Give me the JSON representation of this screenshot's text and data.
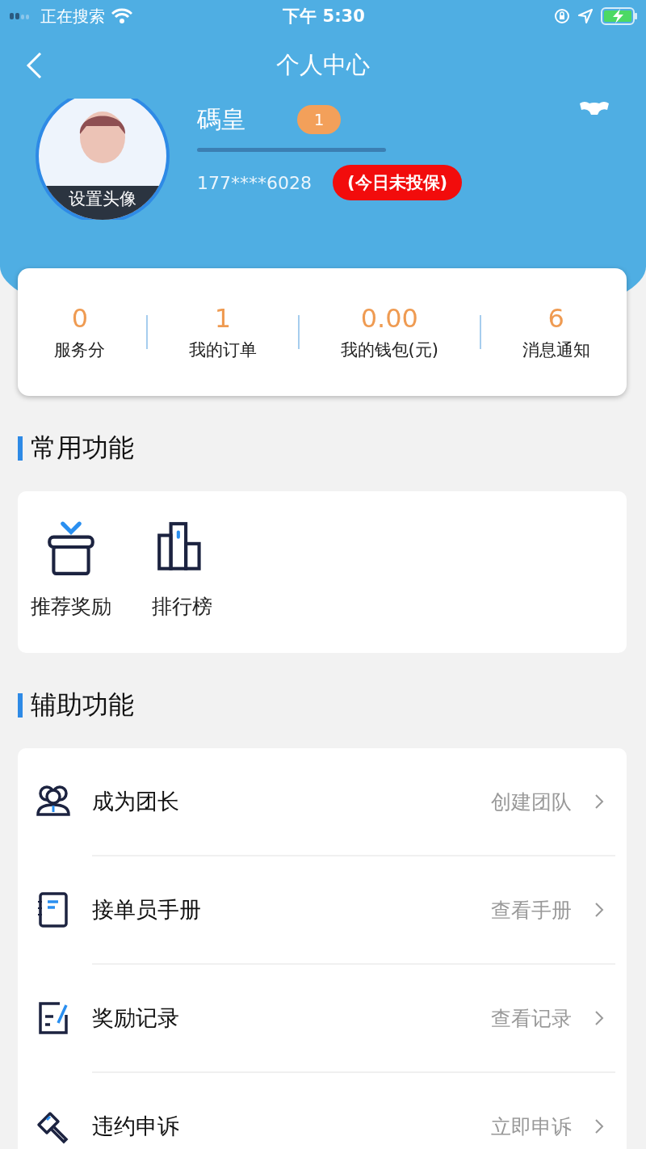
{
  "status_bar": {
    "carrier": "正在搜索",
    "time": "下午 5:30"
  },
  "nav": {
    "title": "个人中心"
  },
  "profile": {
    "avatar_label": "设置头像",
    "name": "碼皇",
    "level_badge": "1",
    "phone": "177****6028",
    "insurance_tag": "(今日未投保)"
  },
  "stats": [
    {
      "value": "0",
      "label": "服务分"
    },
    {
      "value": "1",
      "label": "我的订单"
    },
    {
      "value": "0.00",
      "label": "我的钱包(元)"
    },
    {
      "value": "6",
      "label": "消息通知"
    }
  ],
  "sections": [
    {
      "title": "常用功能",
      "kind": "grid",
      "items": [
        {
          "label": "推荐奖励",
          "kind": "gift"
        },
        {
          "label": "排行榜",
          "kind": "ranking"
        }
      ]
    },
    {
      "title": "辅助功能",
      "kind": "list",
      "items": [
        {
          "label": "成为团长",
          "detail": "创建团队",
          "kind": "team"
        },
        {
          "label": "接单员手册",
          "detail": "查看手册",
          "kind": "notebook"
        },
        {
          "label": "奖励记录",
          "detail": "查看记录",
          "kind": "edit"
        },
        {
          "label": "违约申诉",
          "detail": "立即申诉",
          "kind": "gavel"
        }
      ]
    }
  ]
}
